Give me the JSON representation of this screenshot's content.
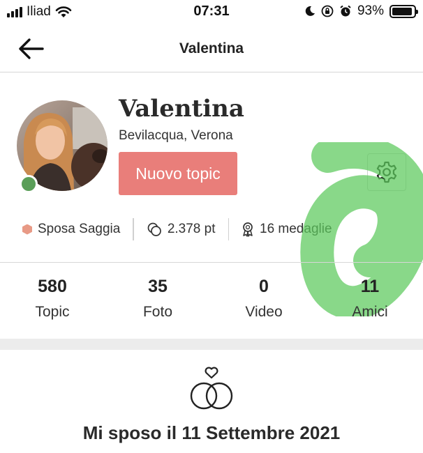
{
  "status_bar": {
    "carrier": "Iliad",
    "time": "07:31",
    "battery": "93%",
    "battery_level": 0.93
  },
  "nav": {
    "title": "Valentina",
    "back_icon": "arrow-left-icon"
  },
  "profile": {
    "name": "Valentina",
    "location": "Bevilacqua, Verona",
    "new_topic_label": "Nuovo topic",
    "online": true,
    "settings_icon": "gear-icon",
    "stats": {
      "rank": "Sposa Saggia",
      "points": "2.378 pt",
      "medals": "16 medaglie"
    }
  },
  "counts": [
    {
      "value": "580",
      "label": "Topic"
    },
    {
      "value": "35",
      "label": "Foto"
    },
    {
      "value": "0",
      "label": "Video"
    },
    {
      "value": "11",
      "label": "Amici"
    }
  ],
  "wedding": {
    "text": "Mi sposo il 11 Settembre 2021",
    "icon": "wedding-rings-icon"
  },
  "colors": {
    "primary": "#e97e7a",
    "online": "#5a9e58",
    "rank_badge": "#e89a86"
  }
}
